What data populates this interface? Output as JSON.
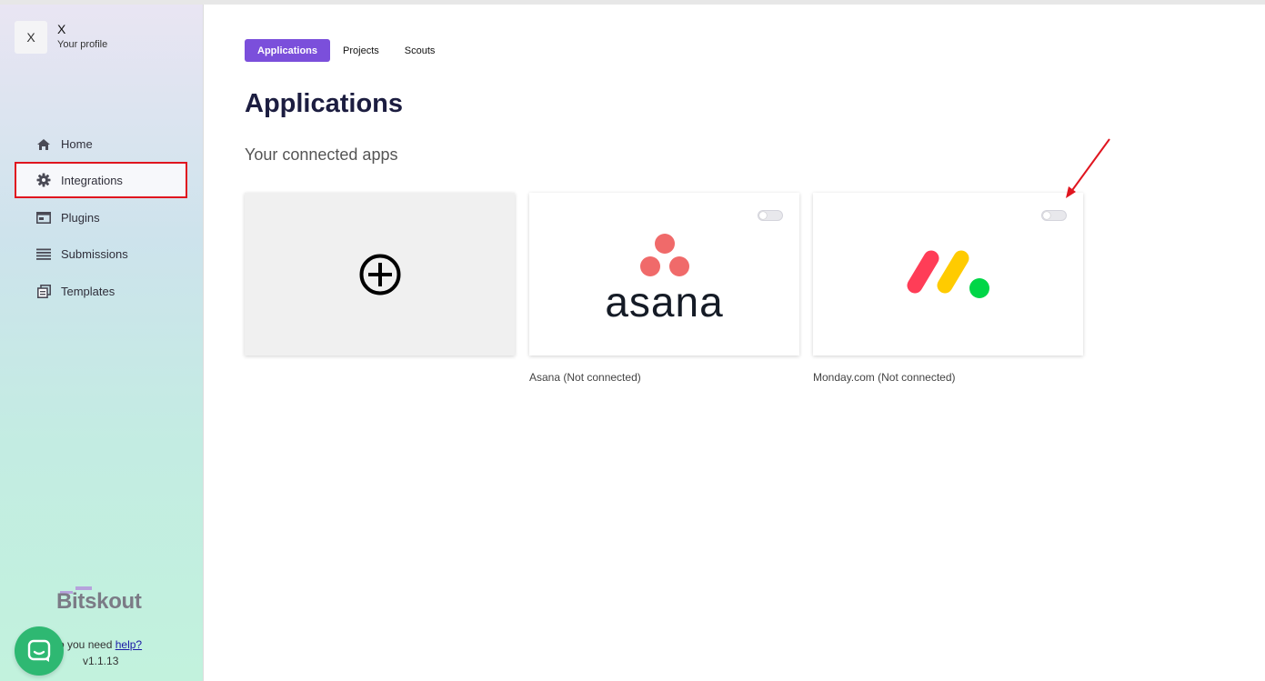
{
  "profile": {
    "initial": "X",
    "name": "X",
    "subtitle": "Your profile"
  },
  "nav": [
    {
      "label": "Home",
      "icon": "home-icon"
    },
    {
      "label": "Integrations",
      "icon": "gear-icon",
      "active": true
    },
    {
      "label": "Plugins",
      "icon": "plugins-icon"
    },
    {
      "label": "Submissions",
      "icon": "list-icon"
    },
    {
      "label": "Templates",
      "icon": "templates-icon"
    }
  ],
  "brand": {
    "logo_text": "Bitskout"
  },
  "help": {
    "prefix": "o you need ",
    "link": "help?"
  },
  "version": "v1.1.13",
  "tabs": [
    {
      "label": "Applications",
      "active": true
    },
    {
      "label": "Projects"
    },
    {
      "label": "Scouts"
    }
  ],
  "main": {
    "title": "Applications",
    "section_title": "Your connected apps",
    "apps": [
      {
        "logo_text": "asana",
        "caption": "Asana (Not connected)",
        "connected": false
      },
      {
        "logo_text": "",
        "caption": "Monday.com (Not connected)",
        "connected": false
      }
    ]
  },
  "colors": {
    "accent": "#7b4fdb",
    "highlight_border": "#e0151f",
    "asana_coral": "#f06a6a",
    "chat_green": "#2eb872"
  }
}
